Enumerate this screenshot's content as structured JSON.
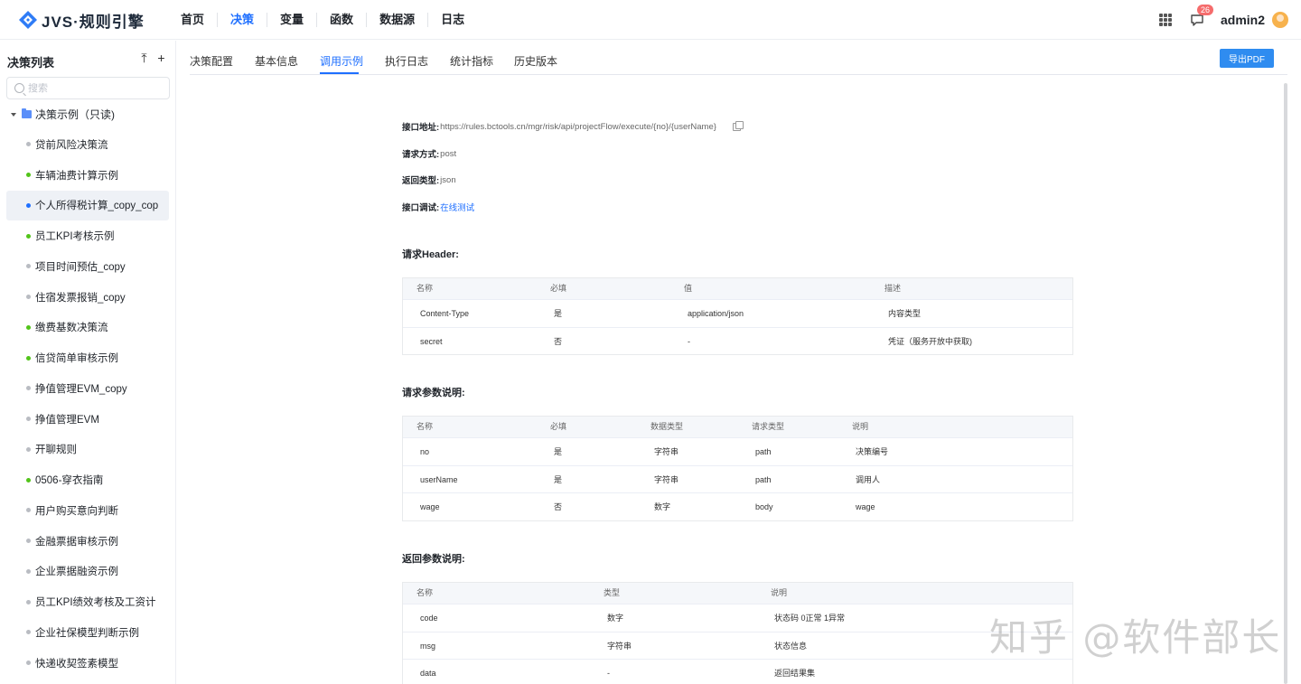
{
  "brand": {
    "logo_text": "JVS·规则引擎",
    "accent": "#1e6fff"
  },
  "nav": [
    {
      "label": "首页",
      "active": false
    },
    {
      "label": "决策",
      "active": true
    },
    {
      "label": "变量",
      "active": false
    },
    {
      "label": "函数",
      "active": false
    },
    {
      "label": "数据源",
      "active": false
    },
    {
      "label": "日志",
      "active": false
    }
  ],
  "user": {
    "notification_count": "26",
    "name": "admin2"
  },
  "sidebar": {
    "title": "决策列表",
    "search_placeholder": "搜索",
    "root_label": "决策示例（只读)",
    "items": [
      {
        "label": "贷前风险决策流",
        "status_color": "#b9bcc2",
        "selected": false
      },
      {
        "label": "车辆油费计算示例",
        "status_color": "#52c41a",
        "selected": false
      },
      {
        "label": "个人所得税计算_copy_cop",
        "status_color": "#1e6fff",
        "selected": true
      },
      {
        "label": "员工KPI考核示例",
        "status_color": "#52c41a",
        "selected": false
      },
      {
        "label": "项目时间预估_copy",
        "status_color": "#b9bcc2",
        "selected": false
      },
      {
        "label": "住宿发票报销_copy",
        "status_color": "#b9bcc2",
        "selected": false
      },
      {
        "label": "缴费基数决策流",
        "status_color": "#52c41a",
        "selected": false
      },
      {
        "label": "信贷简单审核示例",
        "status_color": "#52c41a",
        "selected": false
      },
      {
        "label": "挣值管理EVM_copy",
        "status_color": "#b9bcc2",
        "selected": false
      },
      {
        "label": "挣值管理EVM",
        "status_color": "#b9bcc2",
        "selected": false
      },
      {
        "label": "开聊规则",
        "status_color": "#b9bcc2",
        "selected": false
      },
      {
        "label": "0506-穿衣指南",
        "status_color": "#52c41a",
        "selected": false
      },
      {
        "label": "用户购买意向判断",
        "status_color": "#b9bcc2",
        "selected": false
      },
      {
        "label": "金融票据审核示例",
        "status_color": "#b9bcc2",
        "selected": false
      },
      {
        "label": "企业票据融资示例",
        "status_color": "#b9bcc2",
        "selected": false
      },
      {
        "label": "员工KPI绩效考核及工资计",
        "status_color": "#b9bcc2",
        "selected": false
      },
      {
        "label": "企业社保模型判断示例",
        "status_color": "#b9bcc2",
        "selected": false
      },
      {
        "label": "快递收契签素模型",
        "status_color": "#b9bcc2",
        "selected": false
      }
    ]
  },
  "tabs": [
    {
      "label": "决策配置",
      "active": false
    },
    {
      "label": "基本信息",
      "active": false
    },
    {
      "label": "调用示例",
      "active": true
    },
    {
      "label": "执行日志",
      "active": false
    },
    {
      "label": "统计指标",
      "active": false
    },
    {
      "label": "历史版本",
      "active": false
    }
  ],
  "export_label": "导出PDF",
  "api": {
    "url_label": "接口地址:",
    "url": "https://rules.bctools.cn/mgr/risk/api/projectFlow/execute/{no}/{userName}",
    "method_label": "请求方式:",
    "method": "post",
    "return_type_label": "返回类型:",
    "return_type": "json",
    "debug_label": "接口调试:",
    "debug_link": "在线测试"
  },
  "header_section": {
    "title": "请求Header:",
    "columns": [
      "名称",
      "必填",
      "值",
      "描述"
    ],
    "rows": [
      [
        "Content-Type",
        "是",
        "application/json",
        "内容类型"
      ],
      [
        "secret",
        "否",
        "-",
        "凭证（服务开放中获取)"
      ]
    ]
  },
  "params_section": {
    "title": "请求参数说明:",
    "columns": [
      "名称",
      "必填",
      "数据类型",
      "请求类型",
      "说明"
    ],
    "rows": [
      [
        "no",
        "是",
        "字符串",
        "path",
        "决策编号"
      ],
      [
        "userName",
        "是",
        "字符串",
        "path",
        "调用人"
      ],
      [
        "wage",
        "否",
        "数字",
        "body",
        "wage"
      ]
    ]
  },
  "return_section": {
    "title": "返回参数说明:",
    "columns": [
      "名称",
      "类型",
      "说明"
    ],
    "rows": [
      [
        "code",
        "数字",
        "状态码 0正常 1异常"
      ],
      [
        "msg",
        "字符串",
        "状态信息"
      ],
      [
        "data",
        "-",
        "返回结果集"
      ]
    ]
  },
  "watermark": "知乎 @软件部长"
}
